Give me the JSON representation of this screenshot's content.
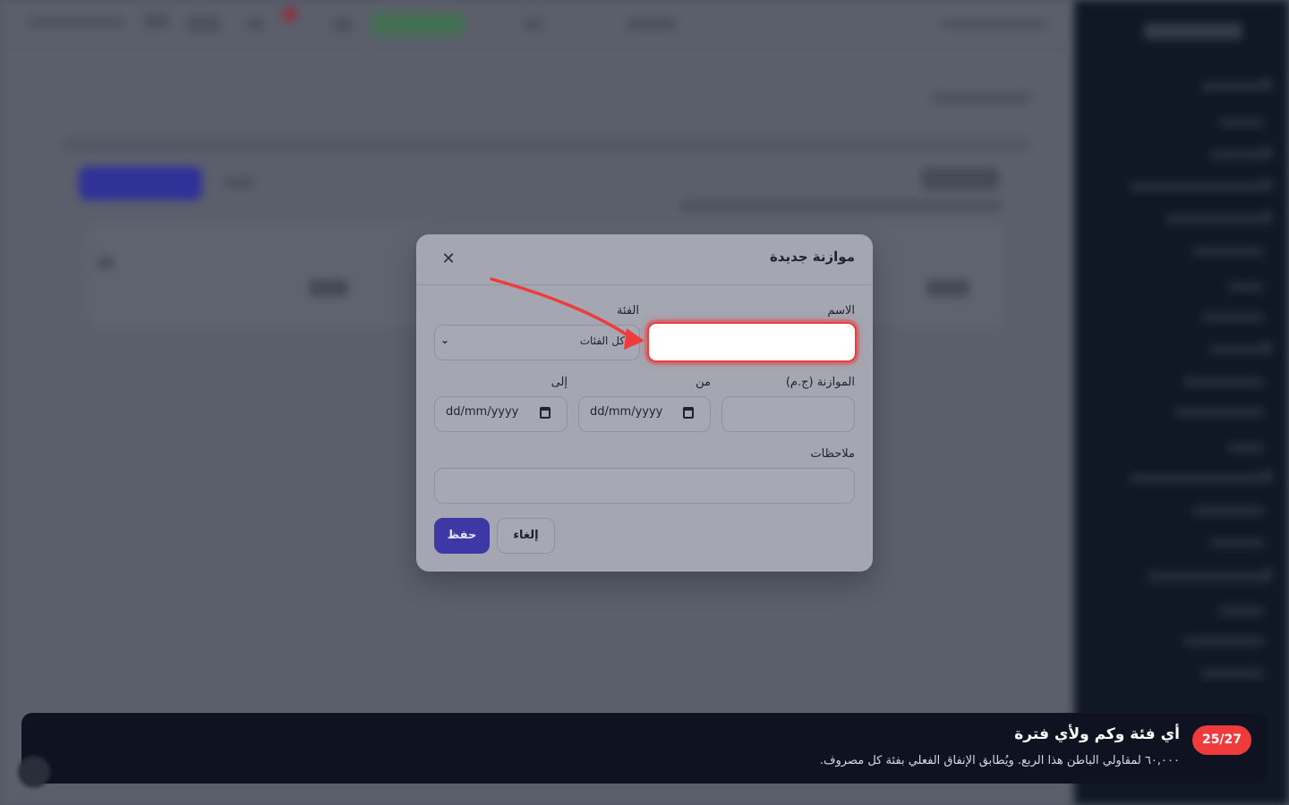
{
  "modal": {
    "title": "موازنة جديدة",
    "close_icon": "close-icon",
    "fields": {
      "name": {
        "label": "الاسم",
        "value": ""
      },
      "category": {
        "label": "الفئة",
        "selected": "كل الفئات"
      },
      "budget": {
        "label": "الموازنة (ج.م)",
        "value": ""
      },
      "from": {
        "label": "من",
        "placeholder": "dd/mm/yyyy"
      },
      "to": {
        "label": "إلى",
        "placeholder": "dd/mm/yyyy"
      },
      "notes": {
        "label": "ملاحظات",
        "value": ""
      }
    },
    "buttons": {
      "save": "حفظ",
      "cancel": "إلغاء"
    }
  },
  "tour": {
    "step": "25/27",
    "title": "أي فئة وكم ولأي فترة",
    "description": "٦٠,٠٠٠ لمقاولي الباطن هذا الربع. ويُطابق الإنفاق الفعلي بفئة كل مصروف."
  },
  "colors": {
    "highlight": "#ef3b3b",
    "primary": "#3d38a6",
    "banner": "#0f1220"
  }
}
